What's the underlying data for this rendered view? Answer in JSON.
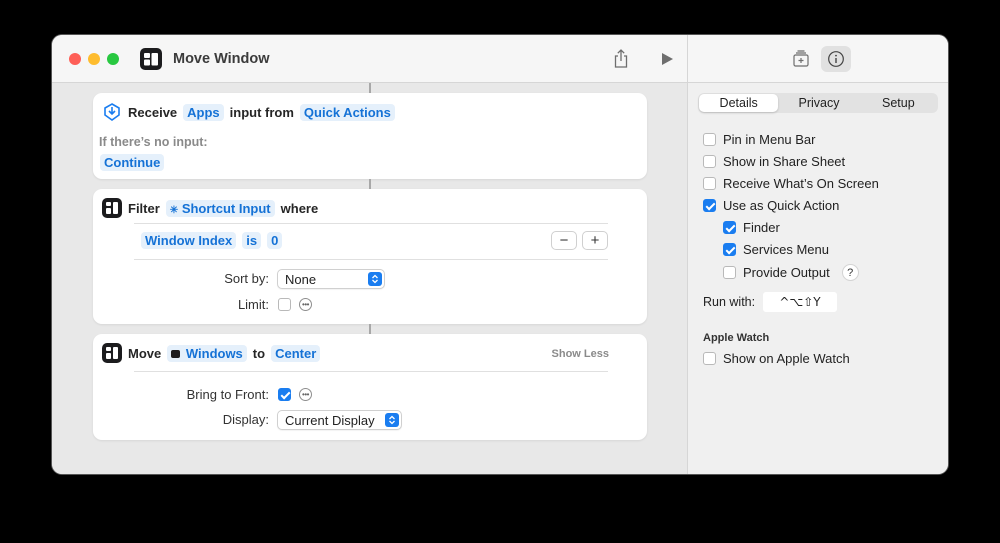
{
  "window": {
    "title": "Move Window"
  },
  "actions": {
    "receive": {
      "verb": "Receive",
      "input_type": "Apps",
      "mid": "input from",
      "source": "Quick Actions",
      "no_input_label": "If there’s no input:",
      "no_input_value": "Continue"
    },
    "filter": {
      "verb": "Filter",
      "input": "Shortcut Input",
      "where": "where",
      "condition_field": "Window Index",
      "condition_op": "is",
      "condition_value": "0",
      "minus": "−",
      "plus": "+",
      "sort_label": "Sort by:",
      "sort_value": "None",
      "limit_label": "Limit:"
    },
    "move": {
      "verb": "Move",
      "target": "Windows",
      "to": "to",
      "position": "Center",
      "show_less": "Show Less",
      "bring_label": "Bring to Front:",
      "display_label": "Display:",
      "display_value": "Current Display"
    }
  },
  "sidebar": {
    "tabs": [
      "Details",
      "Privacy",
      "Setup"
    ],
    "active_tab": "Details",
    "options": [
      {
        "label": "Pin in Menu Bar",
        "checked": false
      },
      {
        "label": "Show in Share Sheet",
        "checked": false
      },
      {
        "label": "Receive What’s On Screen",
        "checked": false
      },
      {
        "label": "Use as Quick Action",
        "checked": true
      }
    ],
    "sub_options": [
      {
        "label": "Finder",
        "checked": true
      },
      {
        "label": "Services Menu",
        "checked": true
      },
      {
        "label": "Provide Output",
        "checked": false
      }
    ],
    "help": "?",
    "run_with_label": "Run with:",
    "run_with_value": "^⌥⇧Y",
    "watch_heading": "Apple Watch",
    "watch_option": {
      "label": "Show on Apple Watch",
      "checked": false
    }
  },
  "colors": {
    "accent": "#1a7df0",
    "token_bg": "#e5f0fb",
    "token_text": "#1572d6"
  }
}
